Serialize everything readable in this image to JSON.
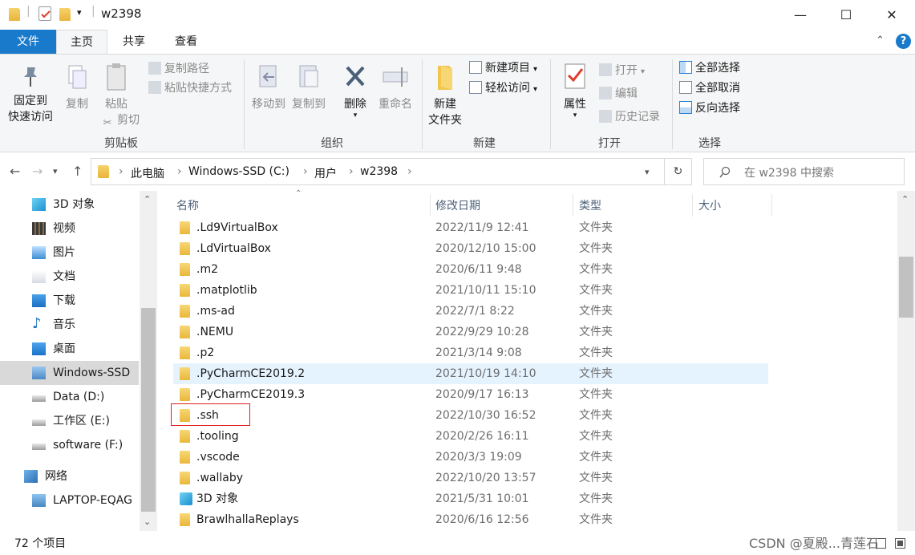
{
  "window": {
    "title": "w2398",
    "minimize_glyph": "—",
    "maximize_glyph": "☐",
    "close_glyph": "✕"
  },
  "ribbon_tabs": [
    "文件",
    "主页",
    "共享",
    "查看"
  ],
  "ribbon": {
    "clipboard": {
      "pin_l1": "固定到",
      "pin_l2": "快速访问",
      "copy": "复制",
      "paste": "粘贴",
      "copy_path": "复制路径",
      "paste_shortcut": "粘贴快捷方式",
      "cut": "剪切",
      "group": "剪贴板"
    },
    "organize": {
      "move_to": "移动到",
      "copy_to": "复制到",
      "delete": "删除",
      "rename": "重命名",
      "group": "组织"
    },
    "new": {
      "new_item": "新建项目",
      "easy_access": "轻松访问",
      "new_folder_l1": "新建",
      "new_folder_l2": "文件夹",
      "group": "新建"
    },
    "open": {
      "properties": "属性",
      "open": "打开",
      "edit": "编辑",
      "history": "历史记录",
      "group": "打开"
    },
    "select": {
      "select_all": "全部选择",
      "select_none": "全部取消",
      "invert": "反向选择",
      "group": "选择"
    }
  },
  "address": {
    "crumbs": [
      "此电脑",
      "Windows-SSD (C:)",
      "用户",
      "w2398"
    ],
    "search_placeholder": "在 w2398 中搜索"
  },
  "nav_pane": [
    {
      "label": "3D 对象",
      "icon": "3d-objects-icon"
    },
    {
      "label": "视频",
      "icon": "video-icon"
    },
    {
      "label": "图片",
      "icon": "pictures-icon"
    },
    {
      "label": "文档",
      "icon": "documents-icon"
    },
    {
      "label": "下载",
      "icon": "downloads-icon"
    },
    {
      "label": "音乐",
      "icon": "music-icon"
    },
    {
      "label": "桌面",
      "icon": "desktop-icon"
    },
    {
      "label": "Windows-SSD",
      "icon": "windows-drive-icon",
      "selected": true
    },
    {
      "label": "Data (D:)",
      "icon": "drive-icon"
    },
    {
      "label": "工作区 (E:)",
      "icon": "drive-icon"
    },
    {
      "label": "software (F:)",
      "icon": "drive-icon"
    },
    {
      "label": "网络",
      "icon": "network-icon"
    },
    {
      "label": "LAPTOP-EQAG",
      "icon": "computer-icon"
    }
  ],
  "columns": {
    "name": "名称",
    "date": "修改日期",
    "type": "类型",
    "size": "大小"
  },
  "files": [
    {
      "name": ".Ld9VirtualBox",
      "date": "2022/11/9 12:41",
      "type": "文件夹"
    },
    {
      "name": ".LdVirtualBox",
      "date": "2020/12/10 15:00",
      "type": "文件夹"
    },
    {
      "name": ".m2",
      "date": "2020/6/11 9:48",
      "type": "文件夹"
    },
    {
      "name": ".matplotlib",
      "date": "2021/10/11 15:10",
      "type": "文件夹"
    },
    {
      "name": ".ms-ad",
      "date": "2022/7/1 8:22",
      "type": "文件夹"
    },
    {
      "name": ".NEMU",
      "date": "2022/9/29 10:28",
      "type": "文件夹"
    },
    {
      "name": ".p2",
      "date": "2021/3/14 9:08",
      "type": "文件夹"
    },
    {
      "name": ".PyCharmCE2019.2",
      "date": "2021/10/19 14:10",
      "type": "文件夹",
      "hover": true
    },
    {
      "name": ".PyCharmCE2019.3",
      "date": "2020/9/17 16:13",
      "type": "文件夹"
    },
    {
      "name": ".ssh",
      "date": "2022/10/30 16:52",
      "type": "文件夹",
      "highlighted": true
    },
    {
      "name": ".tooling",
      "date": "2020/2/26 16:11",
      "type": "文件夹"
    },
    {
      "name": ".vscode",
      "date": "2020/3/3 19:09",
      "type": "文件夹"
    },
    {
      "name": ".wallaby",
      "date": "2022/10/20 13:57",
      "type": "文件夹"
    },
    {
      "name": "3D 对象",
      "date": "2021/5/31 10:01",
      "type": "文件夹",
      "icon": "3d-objects-icon"
    },
    {
      "name": "BrawlhallaReplays",
      "date": "2020/6/16 12:56",
      "type": "文件夹"
    }
  ],
  "status": {
    "item_count": "72 个项目"
  },
  "watermark": "CSDN @夏殿...青莲石",
  "colors": {
    "accent": "#1979ca",
    "hover_row": "#e5f3ff",
    "highlight_box": "#e02020",
    "selected_nav": "#d9d9d9"
  }
}
